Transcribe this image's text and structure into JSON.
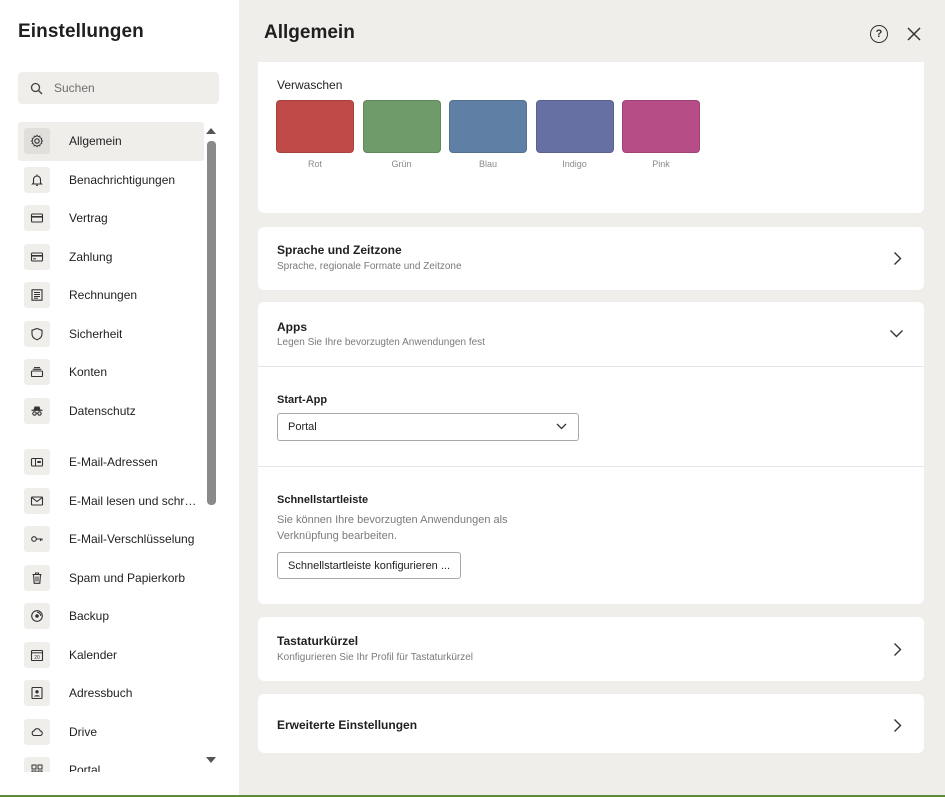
{
  "sidebar": {
    "title": "Einstellungen",
    "search_placeholder": "Suchen",
    "items": [
      {
        "label": "Allgemein",
        "icon": "gear-icon",
        "active": true
      },
      {
        "label": "Benachrichtigungen",
        "icon": "bell-icon"
      },
      {
        "label": "Vertrag",
        "icon": "card-icon"
      },
      {
        "label": "Zahlung",
        "icon": "credit-card-icon"
      },
      {
        "label": "Rechnungen",
        "icon": "invoice-icon"
      },
      {
        "label": "Sicherheit",
        "icon": "shield-icon"
      },
      {
        "label": "Konten",
        "icon": "stack-icon"
      },
      {
        "label": "Datenschutz",
        "icon": "incognito-icon"
      },
      {
        "label": "E-Mail-Adressen",
        "icon": "mailbox-icon"
      },
      {
        "label": "E-Mail lesen und schreiben",
        "icon": "envelope-icon"
      },
      {
        "label": "E-Mail-Verschlüsselung",
        "icon": "key-icon"
      },
      {
        "label": "Spam und Papierkorb",
        "icon": "trash-icon"
      },
      {
        "label": "Backup",
        "icon": "backup-icon"
      },
      {
        "label": "Kalender",
        "icon": "calendar-icon"
      },
      {
        "label": "Adressbuch",
        "icon": "contact-book-icon"
      },
      {
        "label": "Drive",
        "icon": "cloud-icon"
      },
      {
        "label": "Portal",
        "icon": "grid-icon"
      }
    ]
  },
  "header": {
    "title": "Allgemein",
    "help_label": "?"
  },
  "verwaschen": {
    "label": "Verwaschen",
    "swatches": [
      {
        "label": "Rot",
        "color": "#bf4a48"
      },
      {
        "label": "Grün",
        "color": "#6f9a6a"
      },
      {
        "label": "Blau",
        "color": "#5f7fa5"
      },
      {
        "label": "Indigo",
        "color": "#6670a3"
      },
      {
        "label": "Pink",
        "color": "#b64d87"
      }
    ]
  },
  "sprache": {
    "title": "Sprache und Zeitzone",
    "subtitle": "Sprache, regionale Formate und Zeitzone"
  },
  "apps": {
    "title": "Apps",
    "subtitle": "Legen Sie Ihre bevorzugten Anwendungen fest",
    "start_app_label": "Start-App",
    "start_app_value": "Portal",
    "schnellstart_label": "Schnellstartleiste",
    "schnellstart_desc": "Sie können Ihre bevorzugten Anwendungen als Verknüpfung bearbeiten.",
    "config_button": "Schnellstartleiste konfigurieren ..."
  },
  "tastatur": {
    "title": "Tastaturkürzel",
    "subtitle": "Konfigurieren Sie Ihr Profil für Tastaturkürzel"
  },
  "erweitert": {
    "title": "Erweiterte Einstellungen"
  }
}
